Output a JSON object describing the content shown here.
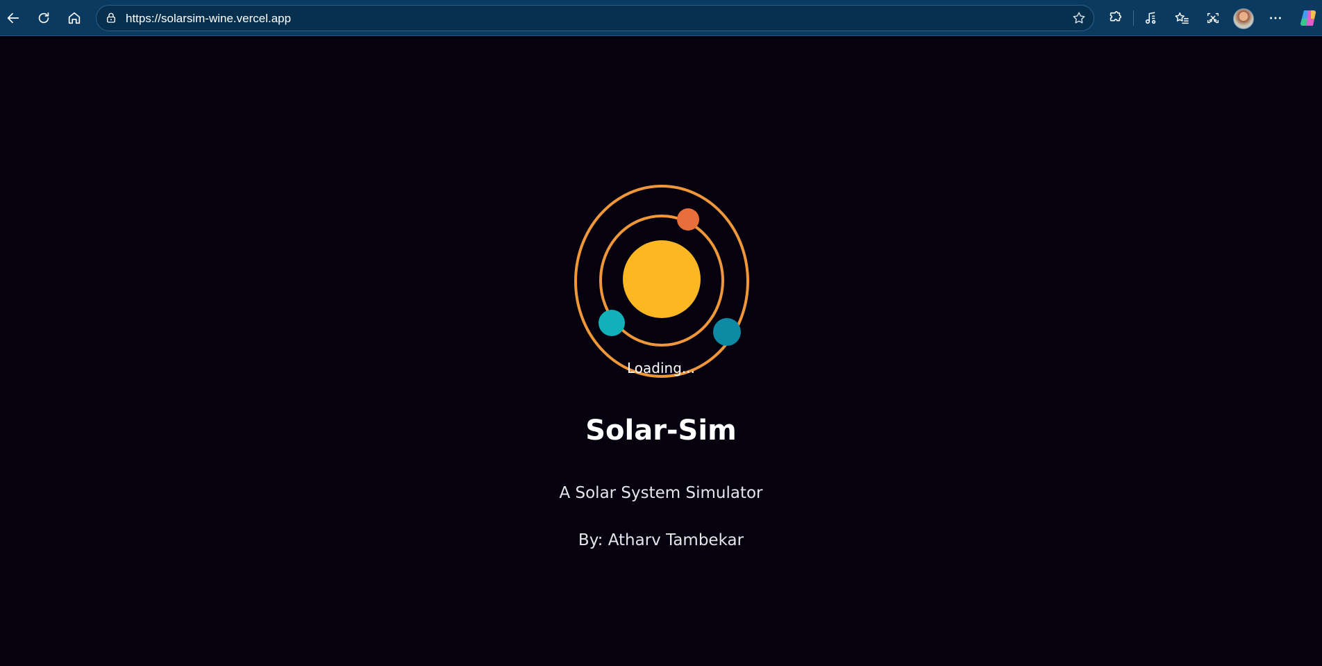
{
  "browser": {
    "url": "https://solarsim-wine.vercel.app",
    "icons": {
      "back": "back-arrow-icon",
      "refresh": "refresh-icon",
      "home": "home-icon",
      "lock": "lock-icon",
      "favorite": "star-icon",
      "extensions": "puzzle-icon",
      "media": "music-note-icon",
      "favorites": "favorites-list-icon",
      "screenshot": "screenshot-icon",
      "more": "more-dots-icon",
      "copilot": "copilot-icon"
    },
    "colors": {
      "toolbar_bg": "#0b3a60",
      "address_bg": "#07304f"
    }
  },
  "page": {
    "loading_text": "Loading...",
    "title": "Solar-Sim",
    "subtitle": "A Solar System Simulator",
    "author": "By: Atharv Tambekar",
    "colors": {
      "background": "#05010e",
      "orbit": "#f0973a",
      "sun": "#fcb723",
      "planet_red": "#e86f3c",
      "planet_teal": "#12b1b9",
      "planet_blue": "#0f8aa5"
    }
  }
}
